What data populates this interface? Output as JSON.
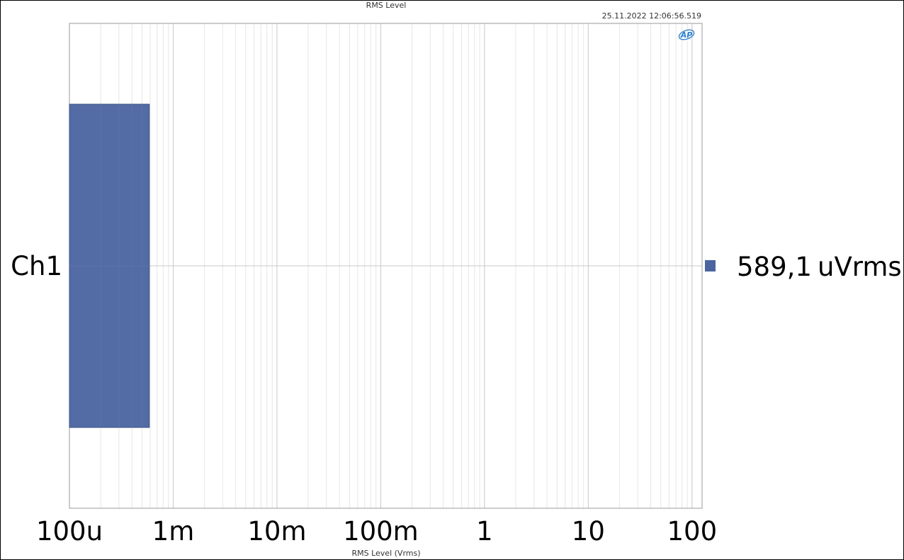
{
  "chart_data": {
    "type": "bar",
    "orientation": "horizontal",
    "title": "RMS Level",
    "timestamp": "25.11.2022 12:06:56.519",
    "xlabel": "RMS Level (Vrms)",
    "x_scale": "log",
    "xlim": [
      0.0001,
      125
    ],
    "x_ticks": [
      {
        "value": 0.0001,
        "label": "100u"
      },
      {
        "value": 0.001,
        "label": "1m"
      },
      {
        "value": 0.01,
        "label": "10m"
      },
      {
        "value": 0.1,
        "label": "100m"
      },
      {
        "value": 1,
        "label": "1"
      },
      {
        "value": 10,
        "label": "10"
      },
      {
        "value": 100,
        "label": "100"
      }
    ],
    "grid": true,
    "categories": [
      "Ch1"
    ],
    "values": [
      0.0005891
    ],
    "value_labels": [
      "589,1",
      "uVrms"
    ],
    "bar_color": "#4a64a0",
    "logo_text": "AP"
  }
}
